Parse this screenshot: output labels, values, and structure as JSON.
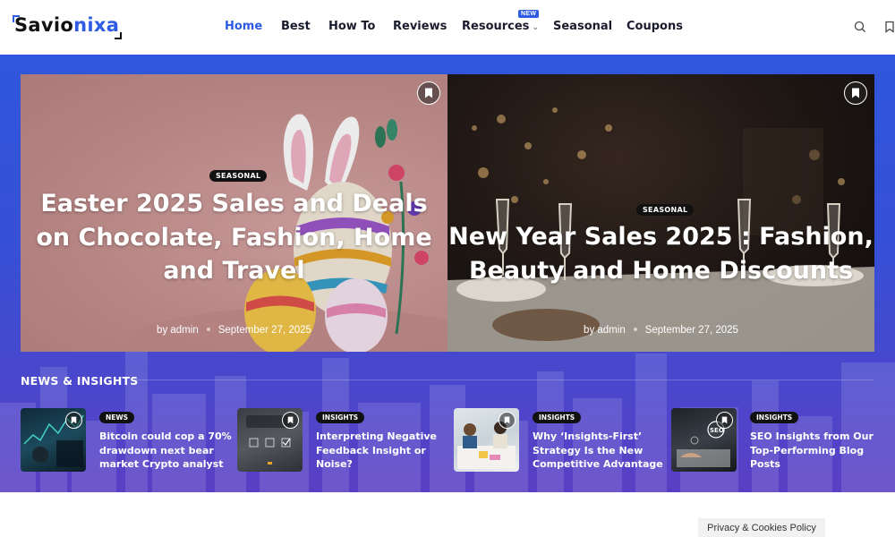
{
  "logo": {
    "part1": "Savio",
    "part2": "nixa"
  },
  "nav": {
    "items": [
      {
        "label": "Home"
      },
      {
        "label": "Best"
      },
      {
        "label": "How To"
      },
      {
        "label": "Reviews"
      },
      {
        "label": "Resources"
      },
      {
        "label": "Seasonal"
      },
      {
        "label": "Coupons"
      }
    ],
    "new_badge": "NEW"
  },
  "header_icons": [
    "search-icon",
    "bookmark-icon"
  ],
  "featured": [
    {
      "category": "SEASONAL",
      "title": "Easter 2025 Sales and Deals on Chocolate, Fashion, Home and Travel",
      "author": "by admin",
      "date": "September 27, 2025"
    },
    {
      "category": "SEASONAL",
      "title": "New Year Sales 2025 : Fashion, Beauty and Home Discounts",
      "author": "by admin",
      "date": "September 27, 2025"
    }
  ],
  "section": {
    "title": "NEWS & INSIGHTS"
  },
  "news": [
    {
      "category": "NEWS",
      "title": "Bitcoin could cop a 70% drawdown next bear market Crypto analyst"
    },
    {
      "category": "INSIGHTS",
      "title": "Interpreting Negative Feedback Insight or Noise?"
    },
    {
      "category": "INSIGHTS",
      "title": "Why ‘Insights-First’ Strategy Is the New Competitive Advantage"
    },
    {
      "category": "INSIGHTS",
      "title": "SEO Insights from Our Top-Performing Blog Posts"
    }
  ],
  "footer": {
    "privacy": "Privacy & Cookies Policy"
  },
  "colors": {
    "accent": "#2d5be3",
    "band_top": "#2f56dc",
    "band_bottom": "#5a3fc4"
  }
}
